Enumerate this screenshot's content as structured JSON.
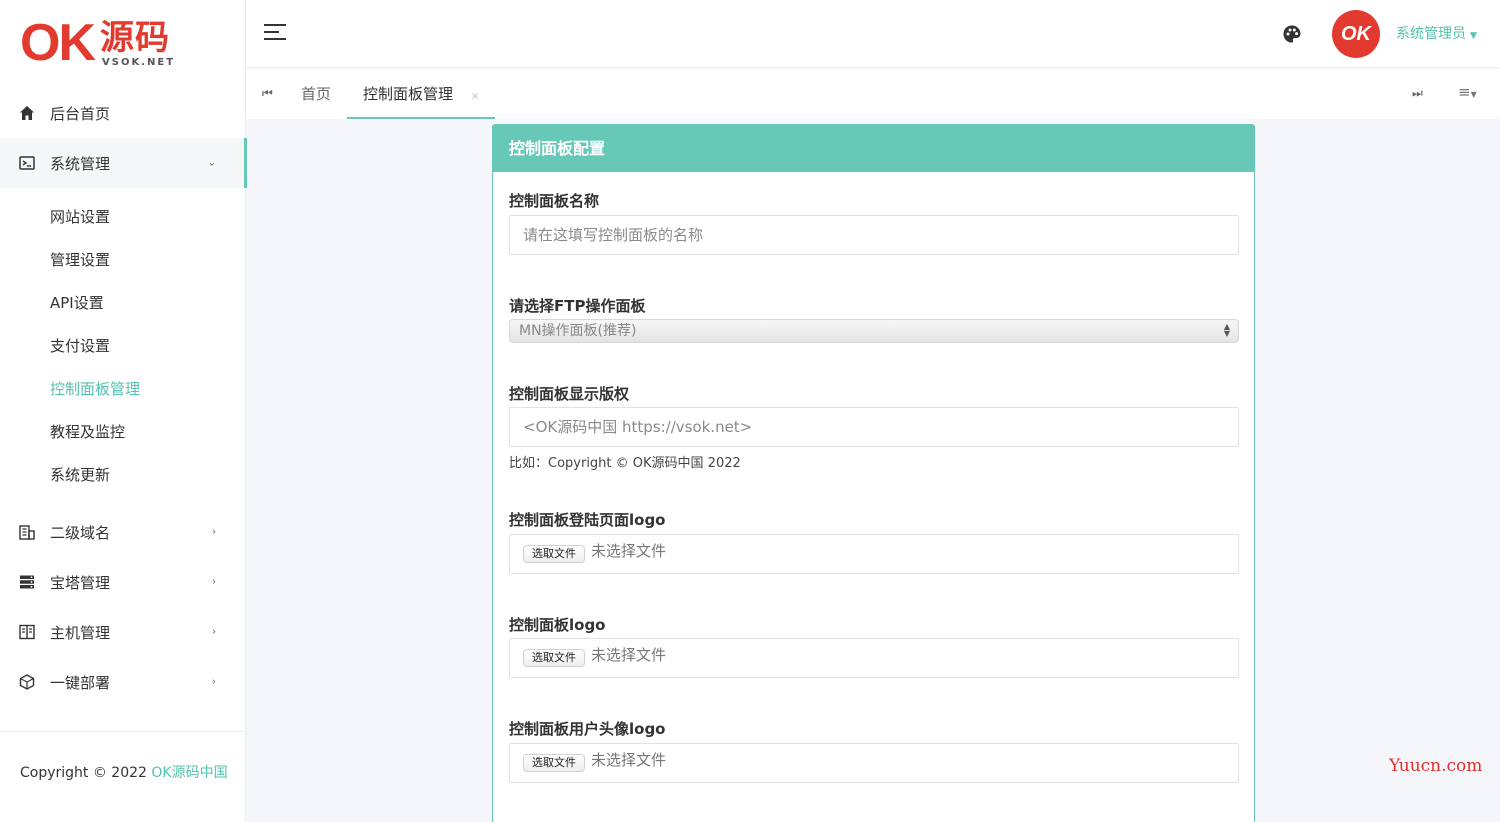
{
  "logo": {
    "mark": "OK",
    "name": "源码",
    "sub": "VSOK.NET"
  },
  "sidebar": {
    "items": [
      {
        "label": "后台首页"
      },
      {
        "label": "系统管理",
        "open": true,
        "children": [
          "网站设置",
          "管理设置",
          "API设置",
          "支付设置",
          "控制面板管理",
          "教程及监控",
          "系统更新"
        ]
      },
      {
        "label": "二级域名"
      },
      {
        "label": "宝塔管理"
      },
      {
        "label": "主机管理"
      },
      {
        "label": "一键部署"
      }
    ],
    "footer_prefix": "Copyright © 2022 ",
    "footer_brand": "OK源码中国"
  },
  "header": {
    "user_name": "系统管理员",
    "avatar_text": "OK"
  },
  "tabs": {
    "home": "首页",
    "current": "控制面板管理",
    "close": "×"
  },
  "panel": {
    "title": "控制面板配置",
    "name_label": "控制面板名称",
    "name_placeholder": "请在这填写控制面板的名称",
    "ftp_label": "请选择FTP操作面板",
    "ftp_selected": "MN操作面板(推荐)",
    "copyright_label": "控制面板显示版权",
    "copyright_value": "<OK源码中国 https://vsok.net>",
    "copyright_hint": "比如：Copyright © OK源码中国 2022",
    "login_logo_label": "控制面板登陆页面logo",
    "logo_label": "控制面板logo",
    "avatar_logo_label": "控制面板用户头像logo",
    "file_button": "选取文件",
    "file_none": "未选择文件"
  },
  "watermark": "Yuucn.com",
  "colors": {
    "accent": "#67c8b8",
    "brand_red": "#e23a2e"
  }
}
